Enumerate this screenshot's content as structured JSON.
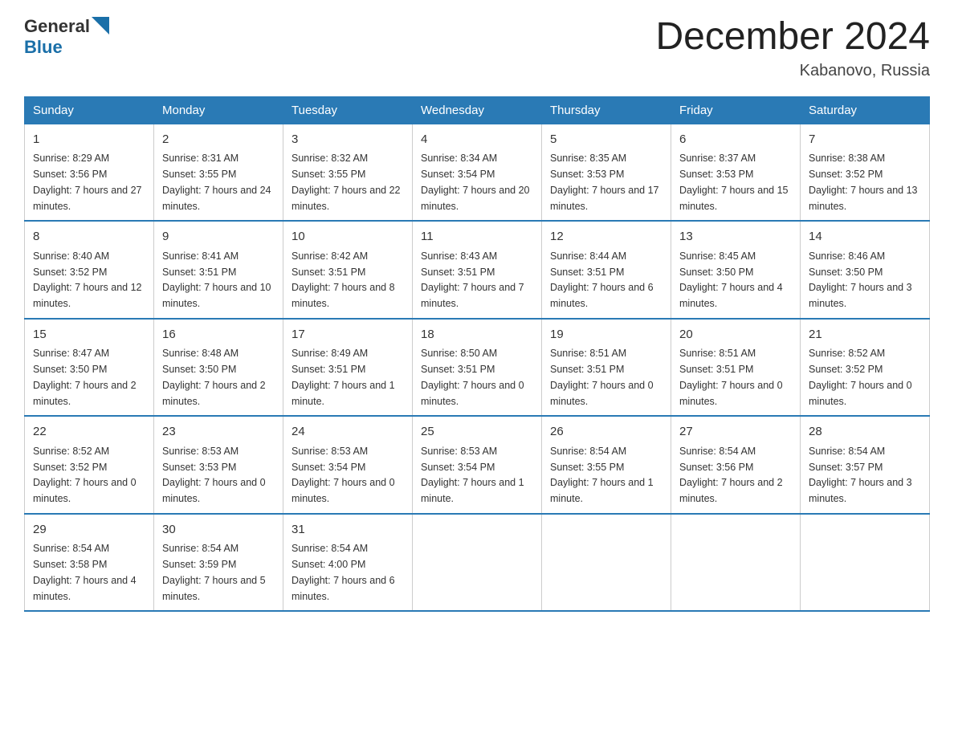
{
  "header": {
    "logo_general": "General",
    "logo_blue": "Blue",
    "month": "December 2024",
    "location": "Kabanovo, Russia"
  },
  "days_of_week": [
    "Sunday",
    "Monday",
    "Tuesday",
    "Wednesday",
    "Thursday",
    "Friday",
    "Saturday"
  ],
  "weeks": [
    [
      {
        "day": "1",
        "sunrise": "8:29 AM",
        "sunset": "3:56 PM",
        "daylight": "7 hours and 27 minutes."
      },
      {
        "day": "2",
        "sunrise": "8:31 AM",
        "sunset": "3:55 PM",
        "daylight": "7 hours and 24 minutes."
      },
      {
        "day": "3",
        "sunrise": "8:32 AM",
        "sunset": "3:55 PM",
        "daylight": "7 hours and 22 minutes."
      },
      {
        "day": "4",
        "sunrise": "8:34 AM",
        "sunset": "3:54 PM",
        "daylight": "7 hours and 20 minutes."
      },
      {
        "day": "5",
        "sunrise": "8:35 AM",
        "sunset": "3:53 PM",
        "daylight": "7 hours and 17 minutes."
      },
      {
        "day": "6",
        "sunrise": "8:37 AM",
        "sunset": "3:53 PM",
        "daylight": "7 hours and 15 minutes."
      },
      {
        "day": "7",
        "sunrise": "8:38 AM",
        "sunset": "3:52 PM",
        "daylight": "7 hours and 13 minutes."
      }
    ],
    [
      {
        "day": "8",
        "sunrise": "8:40 AM",
        "sunset": "3:52 PM",
        "daylight": "7 hours and 12 minutes."
      },
      {
        "day": "9",
        "sunrise": "8:41 AM",
        "sunset": "3:51 PM",
        "daylight": "7 hours and 10 minutes."
      },
      {
        "day": "10",
        "sunrise": "8:42 AM",
        "sunset": "3:51 PM",
        "daylight": "7 hours and 8 minutes."
      },
      {
        "day": "11",
        "sunrise": "8:43 AM",
        "sunset": "3:51 PM",
        "daylight": "7 hours and 7 minutes."
      },
      {
        "day": "12",
        "sunrise": "8:44 AM",
        "sunset": "3:51 PM",
        "daylight": "7 hours and 6 minutes."
      },
      {
        "day": "13",
        "sunrise": "8:45 AM",
        "sunset": "3:50 PM",
        "daylight": "7 hours and 4 minutes."
      },
      {
        "day": "14",
        "sunrise": "8:46 AM",
        "sunset": "3:50 PM",
        "daylight": "7 hours and 3 minutes."
      }
    ],
    [
      {
        "day": "15",
        "sunrise": "8:47 AM",
        "sunset": "3:50 PM",
        "daylight": "7 hours and 2 minutes."
      },
      {
        "day": "16",
        "sunrise": "8:48 AM",
        "sunset": "3:50 PM",
        "daylight": "7 hours and 2 minutes."
      },
      {
        "day": "17",
        "sunrise": "8:49 AM",
        "sunset": "3:51 PM",
        "daylight": "7 hours and 1 minute."
      },
      {
        "day": "18",
        "sunrise": "8:50 AM",
        "sunset": "3:51 PM",
        "daylight": "7 hours and 0 minutes."
      },
      {
        "day": "19",
        "sunrise": "8:51 AM",
        "sunset": "3:51 PM",
        "daylight": "7 hours and 0 minutes."
      },
      {
        "day": "20",
        "sunrise": "8:51 AM",
        "sunset": "3:51 PM",
        "daylight": "7 hours and 0 minutes."
      },
      {
        "day": "21",
        "sunrise": "8:52 AM",
        "sunset": "3:52 PM",
        "daylight": "7 hours and 0 minutes."
      }
    ],
    [
      {
        "day": "22",
        "sunrise": "8:52 AM",
        "sunset": "3:52 PM",
        "daylight": "7 hours and 0 minutes."
      },
      {
        "day": "23",
        "sunrise": "8:53 AM",
        "sunset": "3:53 PM",
        "daylight": "7 hours and 0 minutes."
      },
      {
        "day": "24",
        "sunrise": "8:53 AM",
        "sunset": "3:54 PM",
        "daylight": "7 hours and 0 minutes."
      },
      {
        "day": "25",
        "sunrise": "8:53 AM",
        "sunset": "3:54 PM",
        "daylight": "7 hours and 1 minute."
      },
      {
        "day": "26",
        "sunrise": "8:54 AM",
        "sunset": "3:55 PM",
        "daylight": "7 hours and 1 minute."
      },
      {
        "day": "27",
        "sunrise": "8:54 AM",
        "sunset": "3:56 PM",
        "daylight": "7 hours and 2 minutes."
      },
      {
        "day": "28",
        "sunrise": "8:54 AM",
        "sunset": "3:57 PM",
        "daylight": "7 hours and 3 minutes."
      }
    ],
    [
      {
        "day": "29",
        "sunrise": "8:54 AM",
        "sunset": "3:58 PM",
        "daylight": "7 hours and 4 minutes."
      },
      {
        "day": "30",
        "sunrise": "8:54 AM",
        "sunset": "3:59 PM",
        "daylight": "7 hours and 5 minutes."
      },
      {
        "day": "31",
        "sunrise": "8:54 AM",
        "sunset": "4:00 PM",
        "daylight": "7 hours and 6 minutes."
      },
      null,
      null,
      null,
      null
    ]
  ]
}
